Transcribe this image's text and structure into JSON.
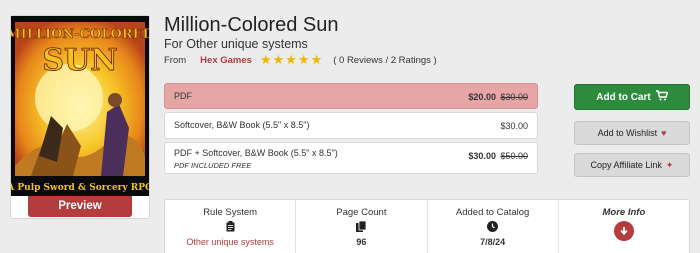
{
  "product": {
    "title": "Million-Colored Sun",
    "subtitle": "For Other unique systems",
    "from_label": "From",
    "publisher": "Hex Games",
    "rating": 5,
    "reviews_text": "( 0 Reviews / 2 Ratings )"
  },
  "cover": {
    "title_line1": "MILLION-COLORED",
    "title_line2": "SUN",
    "tagline": "A Pulp Sword & Sorcery RPG",
    "preview_label": "Preview"
  },
  "formats": [
    {
      "name": "PDF",
      "price": "$20.00",
      "old_price": "$30.00",
      "selected": true
    },
    {
      "name": "Softcover, B&W Book (5.5\" x 8.5\")",
      "price": "$30.00",
      "old_price": ""
    },
    {
      "name": "PDF + Softcover, B&W Book (5.5\" x 8.5\")",
      "note": "PDF INCLUDED FREE",
      "price": "$30.00",
      "old_price": "$50.00"
    }
  ],
  "actions": {
    "add_to_cart": "Add to Cart",
    "wishlist": "Add to Wishlist",
    "affiliate": "Copy Affiliate Link"
  },
  "info": {
    "rule_system_label": "Rule System",
    "rule_system_value": "Other unique systems",
    "page_count_label": "Page Count",
    "page_count_value": "96",
    "added_label": "Added to Catalog",
    "added_value": "7/8/24",
    "more_label": "More Info"
  },
  "colors": {
    "accent": "#b43c3c",
    "cart_green": "#2e8b3d",
    "selected_format": "#e6a6a6",
    "star": "#f0b400"
  },
  "icons": {
    "cart": "shopping-cart-icon",
    "wishlist": "heart-icon",
    "affiliate": "sparkle-icon",
    "rule_system": "clipboard-icon",
    "page_count": "pages-icon",
    "added": "clock-icon",
    "more_info": "arrow-down-circle-icon"
  }
}
